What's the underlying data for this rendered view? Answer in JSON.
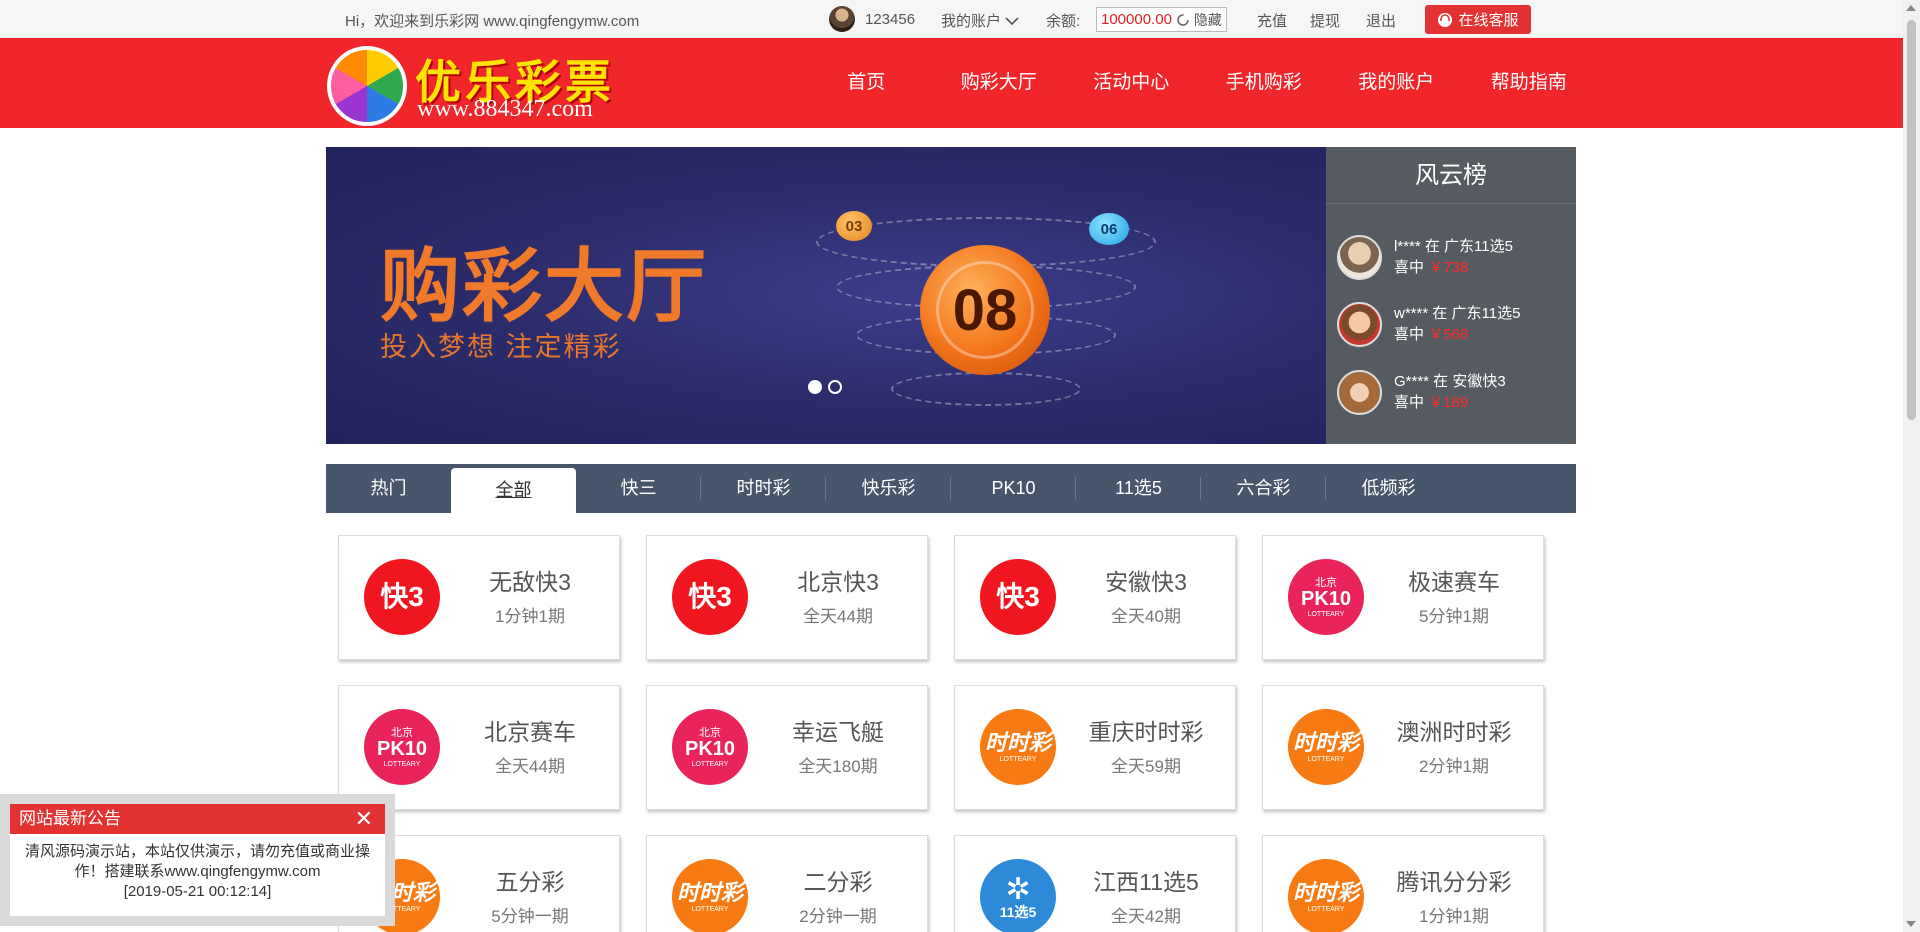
{
  "topbar": {
    "welcome": "Hi，欢迎来到乐彩网 www.qingfengymw.com",
    "username": "123456",
    "account_label": "我的账户",
    "balance_label": "余额:",
    "balance_value": "100000.00",
    "hide_label": "隐藏",
    "recharge": "充值",
    "withdraw": "提现",
    "logout": "退出",
    "service": "在线客服"
  },
  "header": {
    "logo_title": "优乐彩票",
    "logo_url": "www.884347.com",
    "nav": [
      "首页",
      "购彩大厅",
      "活动中心",
      "手机购彩",
      "我的账户",
      "帮助指南"
    ]
  },
  "banner": {
    "title": "购彩大厅",
    "subtitle": "投入梦想  注定精彩",
    "ball_main": "08",
    "ball_a": "03",
    "ball_b": "06"
  },
  "rank": {
    "title": "风云榜",
    "items": [
      {
        "user": "l**** 在 广东11选5",
        "prefix": "喜中",
        "amount": "￥738"
      },
      {
        "user": "w**** 在 广东11选5",
        "prefix": "喜中",
        "amount": "￥568"
      },
      {
        "user": "G**** 在 安徽快3",
        "prefix": "喜中",
        "amount": "￥189"
      }
    ]
  },
  "tabs": [
    "热门",
    "全部",
    "快三",
    "时时彩",
    "快乐彩",
    "PK10",
    "11选5",
    "六合彩",
    "低频彩"
  ],
  "games": [
    {
      "name": "无敌快3",
      "desc": "1分钟1期",
      "icon": "k3-icon",
      "icon_text": "快3"
    },
    {
      "name": "北京快3",
      "desc": "全天44期",
      "icon": "k3-icon",
      "icon_text": "快3"
    },
    {
      "name": "安徽快3",
      "desc": "全天40期",
      "icon": "k3-icon",
      "icon_text": "快3"
    },
    {
      "name": "极速赛车",
      "desc": "5分钟1期",
      "icon": "pk10-icon",
      "icon_text": "PK10"
    },
    {
      "name": "北京赛车",
      "desc": "全天44期",
      "icon": "pk10-icon",
      "icon_text": "PK10"
    },
    {
      "name": "幸运飞艇",
      "desc": "全天180期",
      "icon": "pk10-icon",
      "icon_text": "PK10"
    },
    {
      "name": "重庆时时彩",
      "desc": "全天59期",
      "icon": "ssc-icon",
      "icon_text": "时时彩"
    },
    {
      "name": "澳洲时时彩",
      "desc": "2分钟1期",
      "icon": "ssc-icon",
      "icon_text": "时时彩"
    },
    {
      "name": "五分彩",
      "desc": "5分钟一期",
      "icon": "ssc-icon",
      "icon_text": "时时彩"
    },
    {
      "name": "二分彩",
      "desc": "2分钟一期",
      "icon": "ssc-icon",
      "icon_text": "时时彩"
    },
    {
      "name": "江西11选5",
      "desc": "全天42期",
      "icon": "115-icon",
      "icon_text": "11选5"
    },
    {
      "name": "腾讯分分彩",
      "desc": "1分钟1期",
      "icon": "ssc-icon",
      "icon_text": "时时彩"
    }
  ],
  "icon_sub": {
    "pk10": "北京",
    "lottery": "LOTTEARY"
  },
  "notice": {
    "title": "网站最新公告",
    "close": "✕",
    "body": "清风源码演示站，本站仅供演示，请勿充值或商业操作！搭建联系www.qingfengymw.com",
    "time": "[2019-05-21 00:12:14]"
  },
  "colors": {
    "brand_red": "#f0262b",
    "tab_bar": "#48566b",
    "rank_bg": "#555b61"
  }
}
